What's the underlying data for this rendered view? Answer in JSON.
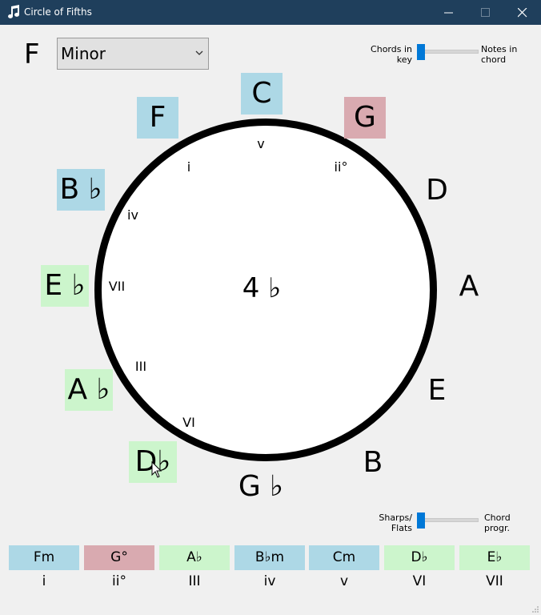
{
  "window": {
    "title": "Circle of Fifths"
  },
  "key": {
    "letter": "F",
    "mode": "Minor"
  },
  "toggles": {
    "top": {
      "left": "Chords in key",
      "left_l1": "Chords in",
      "left_l2": "key",
      "right": "Notes in chord",
      "right_l1": "Notes in",
      "right_l2": "chord"
    },
    "bottom": {
      "left": "Sharps/ Flats",
      "left_l1": "Sharps/",
      "left_l2": "Flats",
      "right": "Chord progr.",
      "right_l1": "Chord",
      "right_l2": "progr."
    }
  },
  "circle": {
    "center": "4 ♭",
    "notes": [
      "C",
      "G",
      "D",
      "A",
      "E",
      "B",
      "G ♭",
      "D♭",
      "A ♭",
      "E ♭",
      "B ♭",
      "F"
    ],
    "degrees": [
      "v",
      "ii°",
      "iv",
      "i",
      "VII",
      "III",
      "VI"
    ]
  },
  "chords": [
    {
      "name": "Fm",
      "degree": "i"
    },
    {
      "name": "G°",
      "degree": "ii°"
    },
    {
      "name": "A♭",
      "degree": "III"
    },
    {
      "name": "B♭m",
      "degree": "iv"
    },
    {
      "name": "Cm",
      "degree": "v"
    },
    {
      "name": "D♭",
      "degree": "VI"
    },
    {
      "name": "E♭",
      "degree": "VII"
    }
  ],
  "colors": {
    "tonic_minor": "#add8e6",
    "diminished": "#d9aab0",
    "major": "#ccf5cc",
    "titlebar": "#1f3f5c",
    "accent": "#0078d7"
  }
}
